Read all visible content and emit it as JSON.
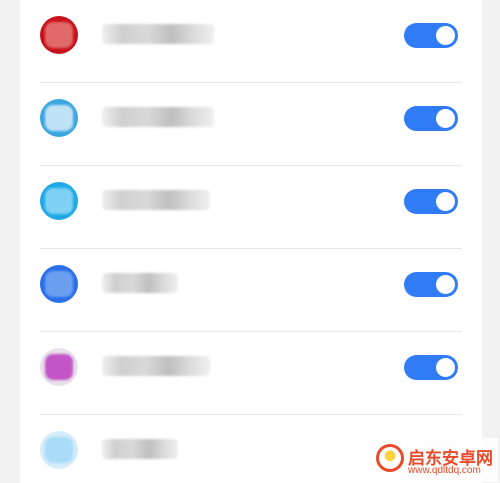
{
  "colors": {
    "page_bg": "#f2f2f2",
    "card_bg": "#ffffff",
    "divider": "#e6e6e6",
    "toggle_on": "#2f7cf6",
    "toggle_knob": "#ffffff"
  },
  "apps": [
    {
      "name": "",
      "icon": "app-icon-red",
      "icon_color": "#c8101a",
      "blur_color": "#e06a6a",
      "enabled": true
    },
    {
      "name": "",
      "icon": "app-icon-lightblue",
      "icon_color": "#3aa6e0",
      "blur_color": "#bfe3f5",
      "enabled": true
    },
    {
      "name": "",
      "icon": "app-icon-cyan",
      "icon_color": "#1fa8e6",
      "blur_color": "#7fd0f2",
      "enabled": true
    },
    {
      "name": "",
      "icon": "app-icon-blue",
      "icon_color": "#2a6ee8",
      "blur_color": "#6a9ff0",
      "enabled": true
    },
    {
      "name": "",
      "icon": "app-icon-pink",
      "icon_color": "#e8e0ea",
      "blur_color": "#c455c8",
      "enabled": true
    },
    {
      "name": "",
      "icon": "app-icon-pale-blue",
      "icon_color": "#d6ecfb",
      "blur_color": "#a8dcf8",
      "enabled": false
    }
  ],
  "watermark": {
    "title": "启东安卓网",
    "url": "www.qdltdq.com"
  }
}
